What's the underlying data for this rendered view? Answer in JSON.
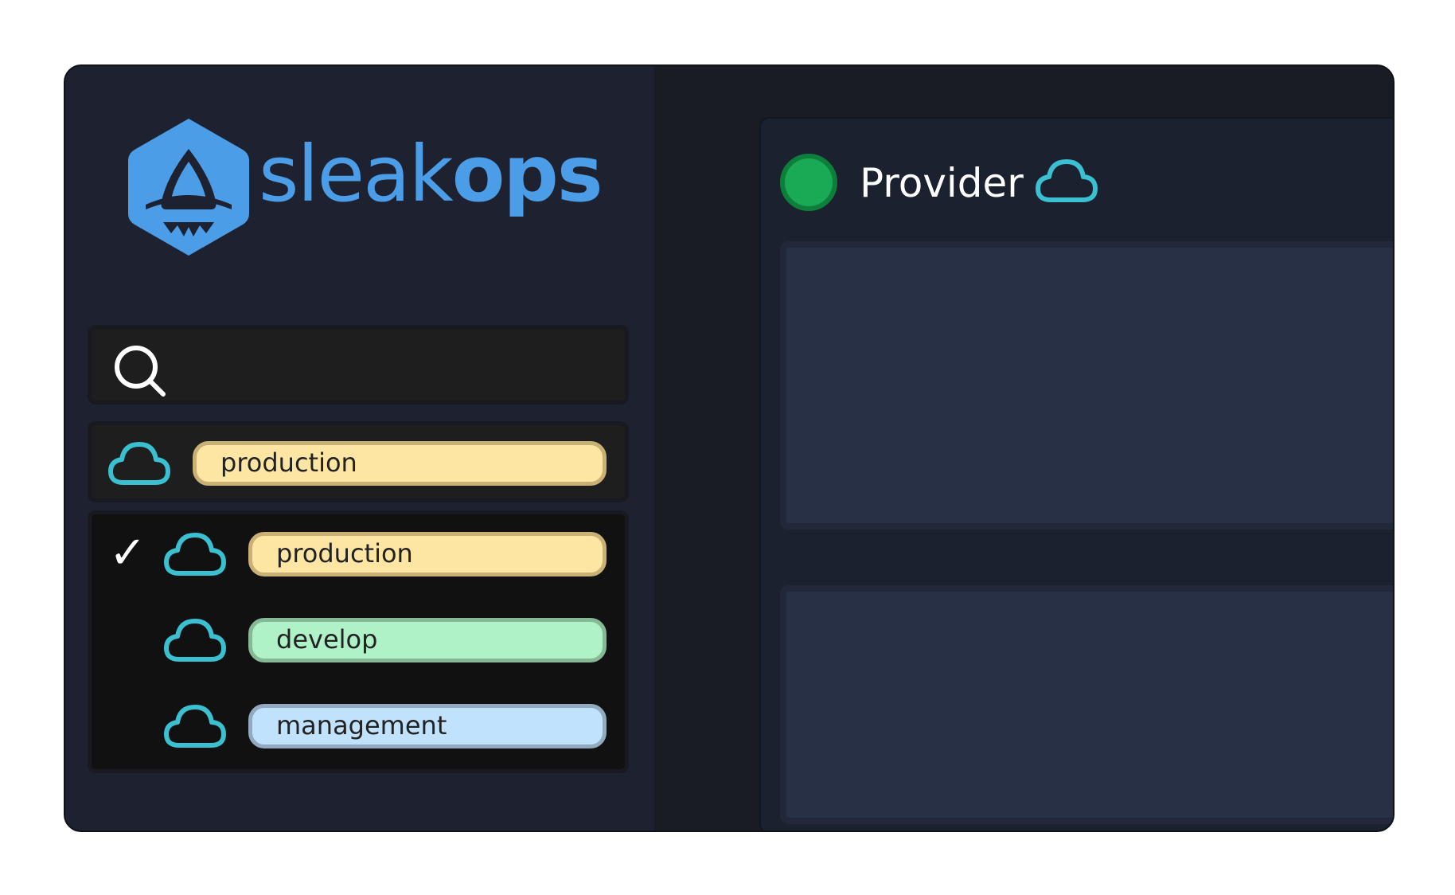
{
  "brand": {
    "name_light": "sleak",
    "name_bold": "ops",
    "logo_icon": "sleakops-hexagon-logo",
    "color": "#4a9de6"
  },
  "search": {
    "icon": "search-icon",
    "value": "",
    "placeholder": ""
  },
  "environment_selector": {
    "selected": {
      "icon": "cloud-icon",
      "label": "production",
      "color": "#fde6a4"
    },
    "options": [
      {
        "label": "production",
        "selected": true,
        "icon": "cloud-icon",
        "color": "#fde6a4"
      },
      {
        "label": "develop",
        "selected": false,
        "icon": "cloud-icon",
        "color": "#aff2c8"
      },
      {
        "label": "management",
        "selected": false,
        "icon": "cloud-icon",
        "color": "#c1e2fc"
      }
    ],
    "check_glyph": "✓"
  },
  "main": {
    "title": "Provider",
    "status_icon": "status-dot",
    "status_color": "#1aa955",
    "title_icon": "cloud-icon",
    "cloud_icon_color": "#3ac0d0"
  }
}
